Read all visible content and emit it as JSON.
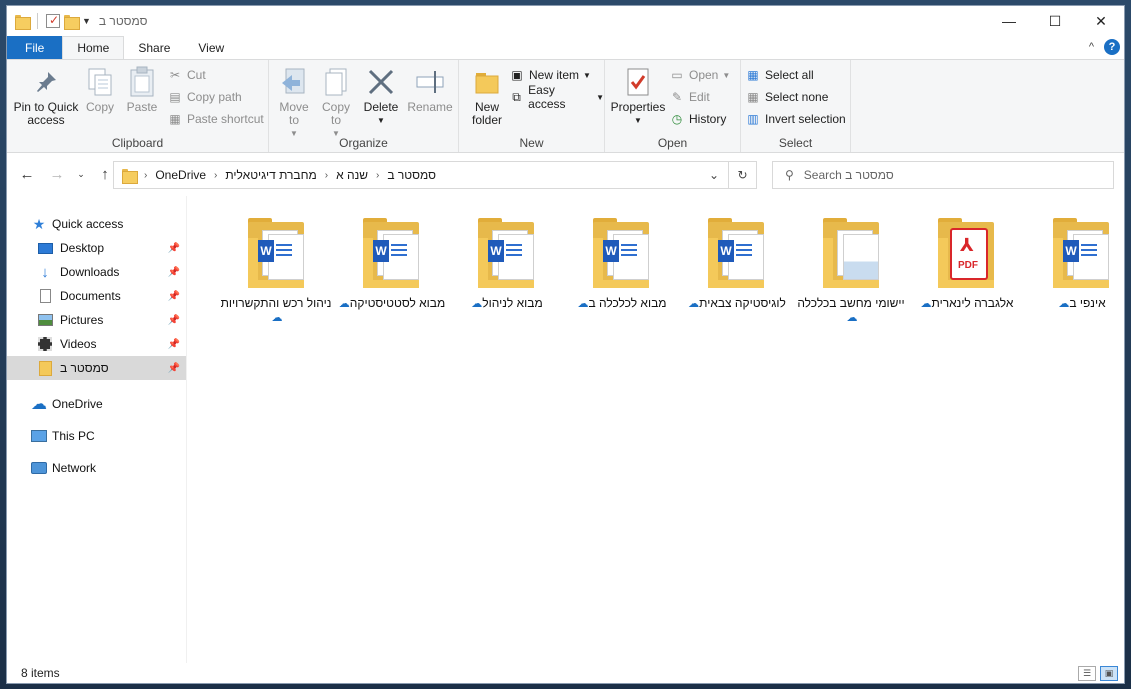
{
  "window": {
    "title": "סמסטר ב",
    "controls": {
      "minimize": "—",
      "maximize": "☐",
      "close": "✕"
    }
  },
  "tabs": [
    {
      "label": "File"
    },
    {
      "label": "Home"
    },
    {
      "label": "Share"
    },
    {
      "label": "View"
    }
  ],
  "ribbon": {
    "clipboard": {
      "label": "Clipboard",
      "pin": "Pin to Quick access",
      "copy": "Copy",
      "paste": "Paste",
      "cut": "Cut",
      "copy_path": "Copy path",
      "paste_shortcut": "Paste shortcut"
    },
    "organize": {
      "label": "Organize",
      "move_to": "Move to",
      "copy_to": "Copy to",
      "delete": "Delete",
      "rename": "Rename"
    },
    "new": {
      "label": "New",
      "new_folder": "New folder",
      "new_item": "New item",
      "easy_access": "Easy access"
    },
    "open": {
      "label": "Open",
      "properties": "Properties",
      "open": "Open",
      "edit": "Edit",
      "history": "History"
    },
    "select": {
      "label": "Select",
      "select_all": "Select all",
      "select_none": "Select none",
      "invert": "Invert selection"
    }
  },
  "address": {
    "crumbs": [
      "OneDrive",
      "מחברת דיגיטאלית",
      "שנה א",
      "סמסטר ב"
    ]
  },
  "search": {
    "placeholder": "Search סמסטר ב"
  },
  "nav": {
    "quick_access": "Quick access",
    "items": [
      {
        "label": "Desktop"
      },
      {
        "label": "Downloads"
      },
      {
        "label": "Documents"
      },
      {
        "label": "Pictures"
      },
      {
        "label": "Videos"
      },
      {
        "label": "סמסטר ב"
      }
    ],
    "onedrive": "OneDrive",
    "this_pc": "This PC",
    "network": "Network"
  },
  "files": [
    {
      "name": "אינפי ב",
      "type": "word"
    },
    {
      "name": "אלגברה לינארית",
      "type": "pdf"
    },
    {
      "name": "יישומי מחשב בכלכלה",
      "type": "folder"
    },
    {
      "name": "לוגיסטיקה צבאית",
      "type": "word"
    },
    {
      "name": "מבוא לכלכלה ב",
      "type": "word"
    },
    {
      "name": "מבוא לניהול",
      "type": "word"
    },
    {
      "name": "מבוא לסטטיסטיקה",
      "type": "word"
    },
    {
      "name": "ניהול רכש והתקשרויות",
      "type": "word"
    }
  ],
  "status": {
    "count": "8 items"
  }
}
